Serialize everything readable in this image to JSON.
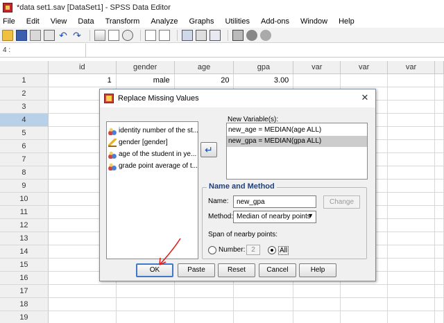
{
  "window": {
    "title": "*data set1.sav [DataSet1] - SPSS Data Editor"
  },
  "menu": [
    "File",
    "Edit",
    "View",
    "Data",
    "Transform",
    "Analyze",
    "Graphs",
    "Utilities",
    "Add-ons",
    "Window",
    "Help"
  ],
  "cell_editor": {
    "ref": "4 :"
  },
  "grid": {
    "columns": [
      "id",
      "gender",
      "age",
      "gpa",
      "var",
      "var",
      "var"
    ],
    "rows": [
      {
        "n": "1",
        "id": "1",
        "gender": "male",
        "age": "20",
        "gpa": "3.00"
      },
      {
        "n": "2"
      },
      {
        "n": "3"
      },
      {
        "n": "4"
      },
      {
        "n": "5"
      },
      {
        "n": "6"
      },
      {
        "n": "7"
      },
      {
        "n": "8"
      },
      {
        "n": "9"
      },
      {
        "n": "10"
      },
      {
        "n": "11"
      },
      {
        "n": "12"
      },
      {
        "n": "13"
      },
      {
        "n": "14"
      },
      {
        "n": "15"
      },
      {
        "n": "16"
      },
      {
        "n": "17"
      },
      {
        "n": "18"
      },
      {
        "n": "19"
      }
    ]
  },
  "dialog": {
    "title": "Replace Missing Values",
    "source_variables": [
      {
        "label": "identity number of the st...",
        "icon": "scale-variable-icon"
      },
      {
        "label": "gender  [gender]",
        "icon": "nominal-variable-icon"
      },
      {
        "label": "age of the student in ye...",
        "icon": "scale-variable-icon"
      },
      {
        "label": "grade point average of t...",
        "icon": "scale-variable-icon"
      }
    ],
    "new_variables_label": "New Variable(s):",
    "new_variables": [
      "new_age = MEDIAN(age ALL)",
      "new_gpa = MEDIAN(gpa ALL)"
    ],
    "group_title": "Name and Method",
    "name_label": "Name:",
    "name_value": "new_gpa",
    "change_button": "Change",
    "method_label": "Method:",
    "method_value": "Median of nearby points",
    "span_label": "Span of nearby points:",
    "number_label": "Number:",
    "number_value": "2",
    "all_label": "All",
    "buttons": {
      "ok": "OK",
      "paste": "Paste",
      "reset": "Reset",
      "cancel": "Cancel",
      "help": "Help"
    }
  },
  "colors": {
    "selection": "#a9c8e6",
    "group_title": "#1f3f7a",
    "annotation_arrow": "#e0201c"
  }
}
